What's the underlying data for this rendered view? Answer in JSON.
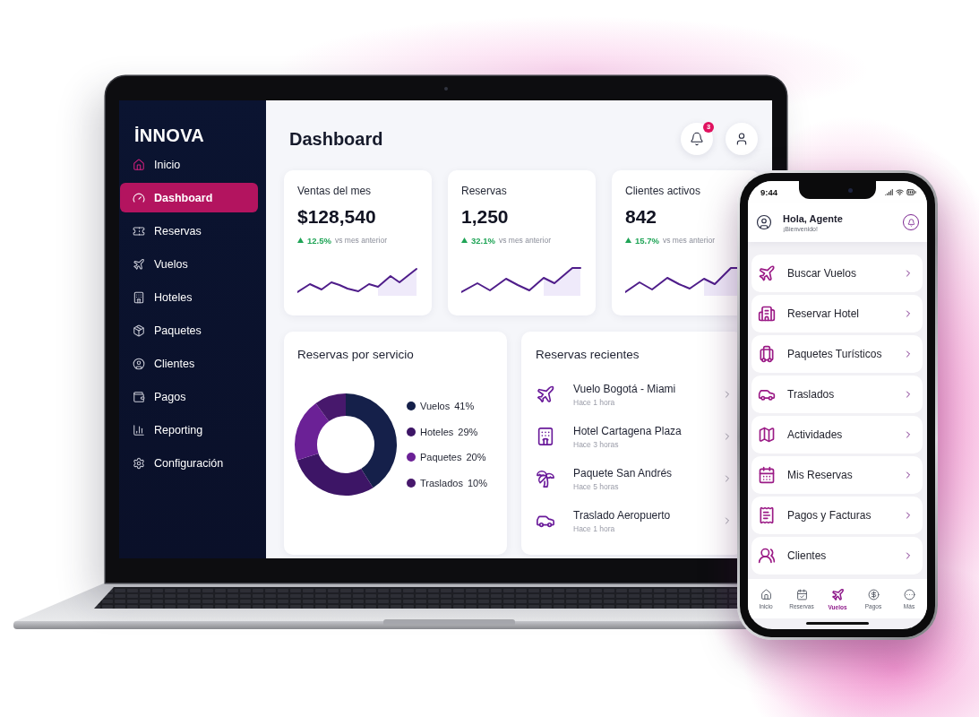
{
  "laptop": {
    "sidebar": {
      "logo": "İNNOVA",
      "items": [
        {
          "label": "Inicio",
          "selected": false
        },
        {
          "label": "Dashboard",
          "selected": true
        },
        {
          "label": "Reservas",
          "selected": false
        },
        {
          "label": "Vuelos",
          "selected": false
        },
        {
          "label": "Hoteles",
          "selected": false
        },
        {
          "label": "Paquetes",
          "selected": false
        },
        {
          "label": "Clientes",
          "selected": false
        },
        {
          "label": "Pagos",
          "selected": false
        },
        {
          "label": "Reporting",
          "selected": false
        },
        {
          "label": "Configuración",
          "selected": false
        }
      ]
    },
    "header": {
      "title": "Dashboard",
      "notification_count": "3"
    },
    "stats": [
      {
        "title": "Ventas del mes",
        "value": "$128,540",
        "change": "12.5%",
        "note": "vs mes anterior"
      },
      {
        "title": "Reservas",
        "value": "1,250",
        "change": "32.1%",
        "note": "vs mes anterior"
      },
      {
        "title": "Clientes activos",
        "value": "842",
        "change": "15.7%",
        "note": "vs mes anterior"
      }
    ],
    "services_card": {
      "title": "Reservas por servicio",
      "chart_data": {
        "type": "donut",
        "categories": [
          "Vuelos",
          "Hoteles",
          "Paquetes",
          "Traslados"
        ],
        "values": [
          41,
          29,
          20,
          10
        ]
      },
      "legend": [
        {
          "share": "41%",
          "color": "#15204a"
        },
        {
          "share": "29%",
          "color": "#3d1566"
        },
        {
          "share": "20%",
          "color": "#6b2196"
        },
        {
          "share": "10%",
          "color": "#47186c"
        }
      ]
    },
    "recent_card": {
      "title": "Reservas recientes",
      "items": [
        {
          "title": "Vuelo Bogotá - Miami",
          "time": "Hace 1 hora"
        },
        {
          "title": "Hotel Cartagena Plaza",
          "time": "Hace 3 horas"
        },
        {
          "title": "Paquete San Andrés",
          "time": "Hace 5 horas"
        },
        {
          "title": "Traslado Aeropuerto",
          "time": "Hace 1 hora"
        }
      ]
    }
  },
  "phone": {
    "status_bar": {
      "time": "9:44"
    },
    "header": {
      "greeting": "Hola, Agente",
      "subtitle": "¡Bienvenido!"
    },
    "menu": [
      "Buscar Vuelos",
      "Reservar Hotel",
      "Paquetes Turísticos",
      "Traslados",
      "Actividades",
      "Mis Reservas",
      "Pagos y Facturas",
      "Clientes"
    ],
    "tab_bar": [
      {
        "label": "Inicio",
        "selected": false
      },
      {
        "label": "Reservas",
        "selected": false
      },
      {
        "label": "Vuelos",
        "selected": true
      },
      {
        "label": "Pagos",
        "selected": false
      },
      {
        "label": "Más",
        "selected": false
      }
    ]
  }
}
